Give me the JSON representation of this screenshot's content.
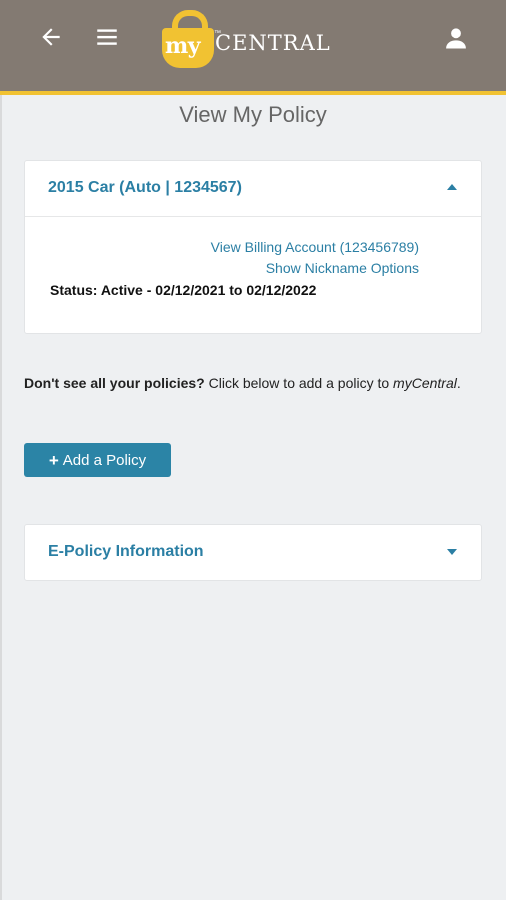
{
  "header": {
    "logo_my": "my",
    "logo_tm": "™",
    "logo_central": "CENTRAL",
    "icons": {
      "back": "back-arrow-icon",
      "menu": "hamburger-menu-icon",
      "user": "user-icon"
    },
    "colors": {
      "bar": "#837a72",
      "accent": "#f1c232"
    }
  },
  "page": {
    "title": "View My Policy"
  },
  "policy": {
    "title": "2015 Car (Auto | 1234567)",
    "billing_link": "View Billing Account (123456789)",
    "nickname_link": "Show Nickname Options",
    "status": "Status: Active - 02/12/2021 to 02/12/2022"
  },
  "info": {
    "question": "Don't see all your policies?",
    "text": " Click below to add a policy to ",
    "brand": "myCentral",
    "end": "."
  },
  "add_button": {
    "icon": "+",
    "label": "Add a Policy"
  },
  "epolicy": {
    "title": "E-Policy Information"
  }
}
